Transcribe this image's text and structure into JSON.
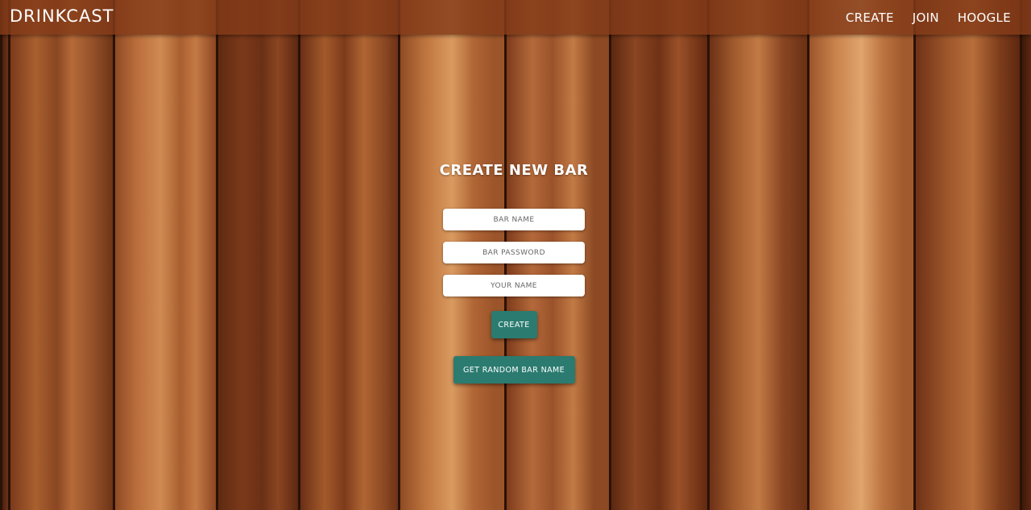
{
  "nav": {
    "brand": "DRINKCAST",
    "links": [
      "CREATE",
      "JOIN",
      "HOOGLE"
    ]
  },
  "form": {
    "title": "CREATE NEW BAR",
    "bar_name_placeholder": "BAR NAME",
    "bar_password_placeholder": "BAR PASSWORD",
    "your_name_placeholder": "YOUR NAME",
    "create_label": "CREATE",
    "random_label": "GET RANDOM BAR NAME"
  },
  "colors": {
    "navbar": "#823a19",
    "button": "#2b7b70",
    "wood_light": "#b8683a",
    "wood_dark": "#5a2810"
  }
}
